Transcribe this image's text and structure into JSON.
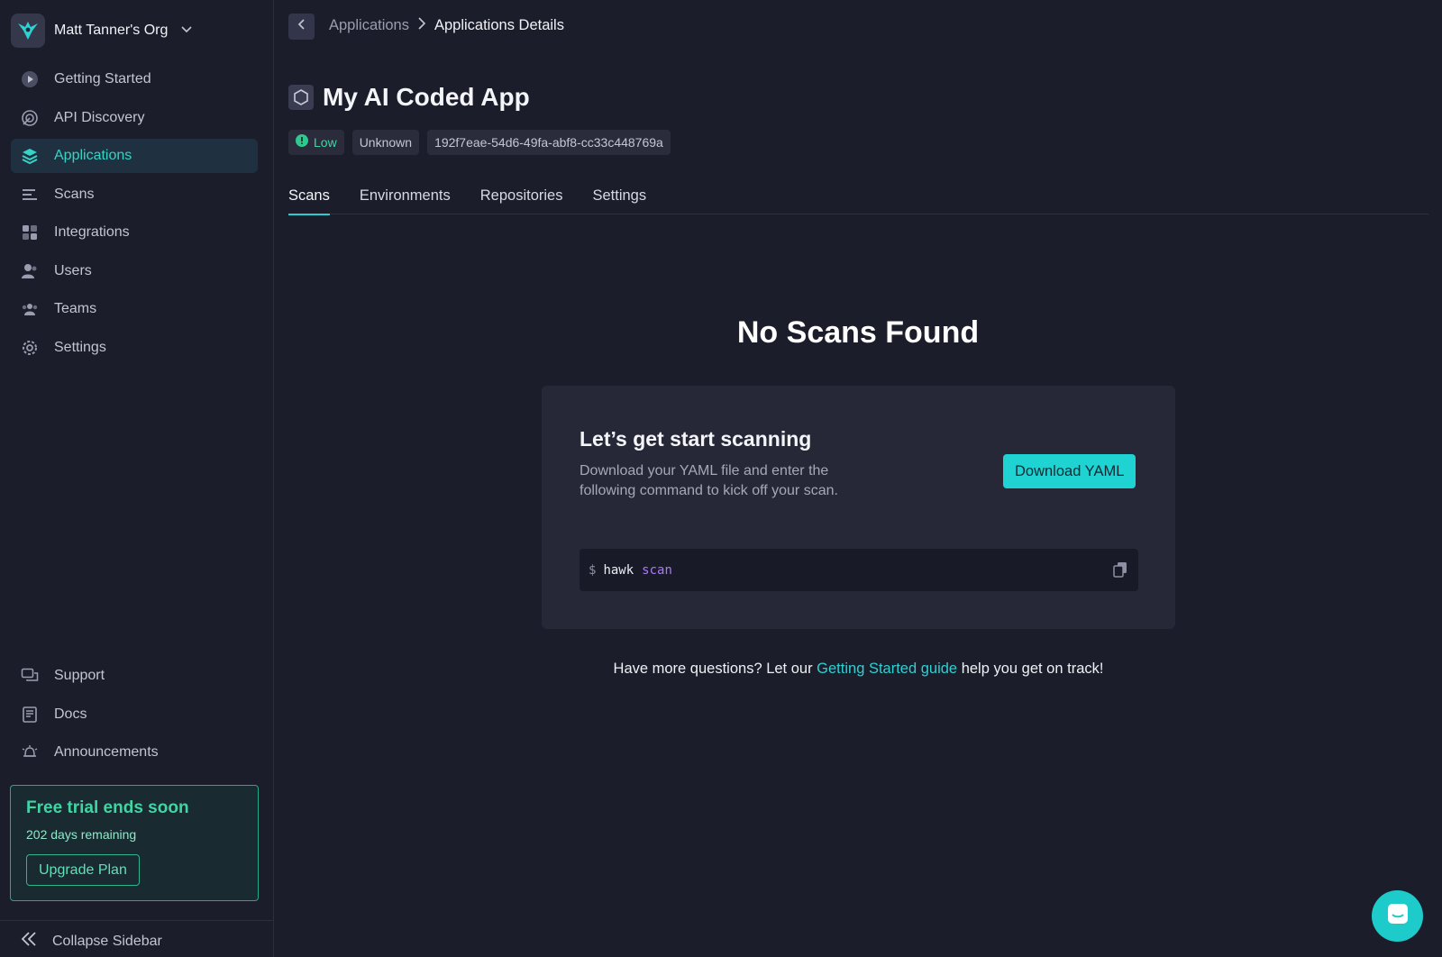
{
  "org": {
    "name": "Matt Tanner's Org"
  },
  "sidebar": {
    "items": [
      {
        "label": "Getting Started",
        "icon": "play-circle-icon"
      },
      {
        "label": "API Discovery",
        "icon": "radar-icon"
      },
      {
        "label": "Applications",
        "icon": "layers-icon",
        "active": true
      },
      {
        "label": "Scans",
        "icon": "list-icon"
      },
      {
        "label": "Integrations",
        "icon": "grid-icon"
      },
      {
        "label": "Users",
        "icon": "user-icon"
      },
      {
        "label": "Teams",
        "icon": "team-icon"
      },
      {
        "label": "Settings",
        "icon": "gear-icon"
      }
    ],
    "bottom_items": [
      {
        "label": "Support",
        "icon": "chat-bubbles-icon"
      },
      {
        "label": "Docs",
        "icon": "book-icon"
      },
      {
        "label": "Announcements",
        "icon": "bell-icon"
      }
    ],
    "trial": {
      "title": "Free trial ends soon",
      "remaining": "202 days remaining",
      "button": "Upgrade Plan"
    },
    "collapse_label": "Collapse Sidebar"
  },
  "breadcrumb": {
    "parent": "Applications",
    "current": "Applications Details"
  },
  "app": {
    "title": "My AI Coded App",
    "badges": {
      "risk": "Low",
      "status": "Unknown",
      "id": "192f7eae-54d6-49fa-abf8-cc33c448769a"
    }
  },
  "tabs": [
    "Scans",
    "Environments",
    "Repositories",
    "Settings"
  ],
  "empty": {
    "title": "No Scans Found",
    "card_title": "Let’s get start scanning",
    "card_desc": "Download your YAML file and enter the following command to kick off your scan.",
    "download_button": "Download YAML",
    "command": {
      "prompt": "$",
      "bin": "hawk",
      "arg": "scan"
    },
    "help_prefix": "Have more questions? Let our ",
    "help_link": "Getting Started guide",
    "help_suffix": " help you get on track!"
  },
  "colors": {
    "accent": "#1ed3d1",
    "success": "#3fd6a4",
    "background": "#1c1d2b"
  }
}
